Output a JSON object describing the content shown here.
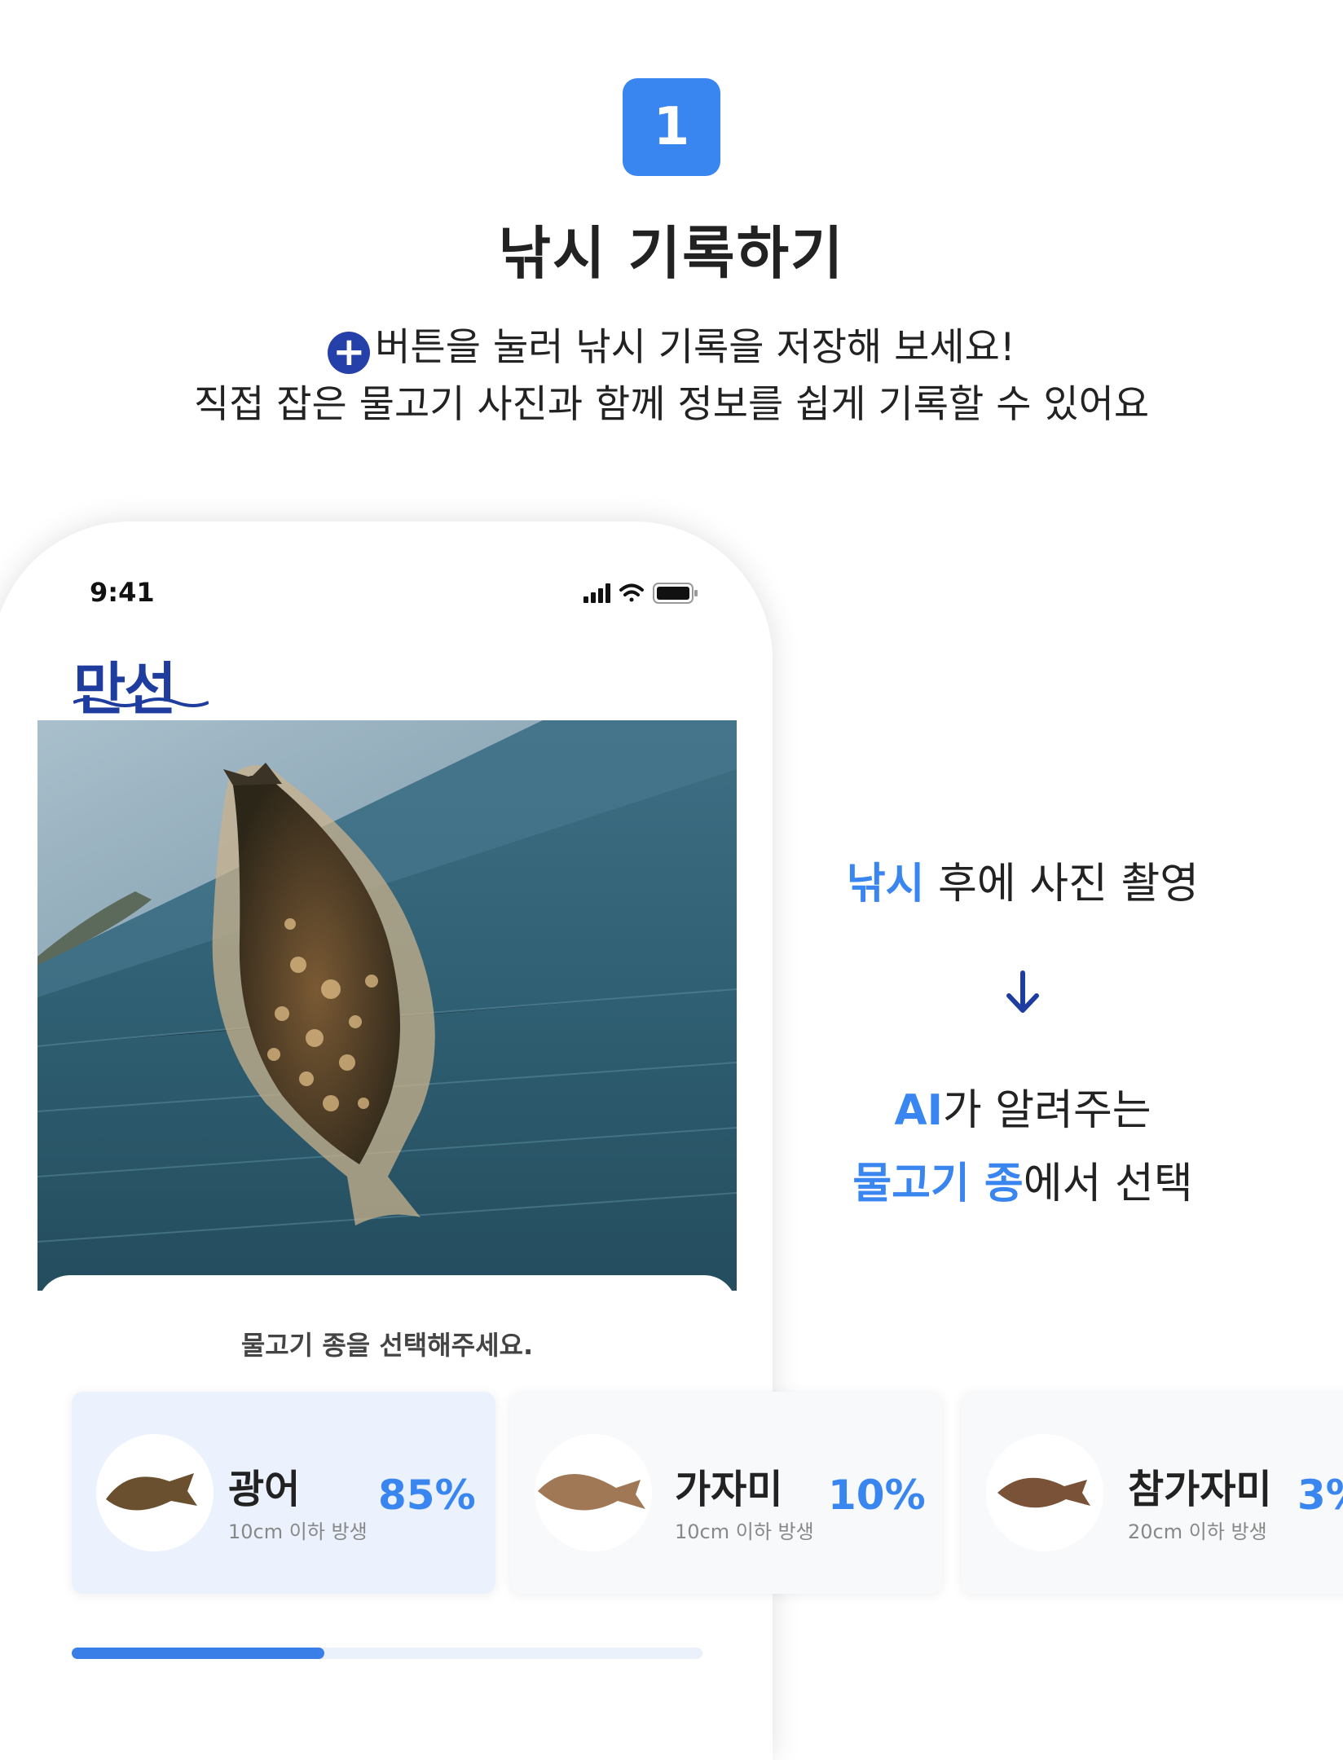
{
  "header": {
    "step_number": "1",
    "title": "낚시 기록하기",
    "desc_line1": "버튼을 눌러 낚시 기록을 저장해 보세요!",
    "desc_line2": "직접 잡은 물고기 사진과 함께 정보를 쉽게 기록할 수 있어요",
    "plus_icon_glyph": "+"
  },
  "phone": {
    "status_time": "9:41",
    "brand": "만선",
    "sheet_title": "물고기 종을 선택해주세요.",
    "species": [
      {
        "name": "광어",
        "sub": "10cm 이하 방생",
        "pct": "85%",
        "selected": true
      },
      {
        "name": "가자미",
        "sub": "10cm 이하 방생",
        "pct": "10%",
        "selected": false
      },
      {
        "name": "참가자미",
        "sub": "20cm 이하 방생",
        "pct": "3%",
        "selected": false
      }
    ],
    "progress_fraction": 0.4
  },
  "flow": {
    "step1_hl": "낚시",
    "step1_rest": " 후에 사진 촬영",
    "step2_hl_a": "AI",
    "step2_rest_a": "가 알려주는",
    "step2_hl_b": "물고기 종",
    "step2_rest_b": "에서 선택"
  },
  "colors": {
    "accent": "#3a86f0",
    "brand": "#1f3d9e",
    "selected_card": "#ebf2fd"
  },
  "icons": [
    "plus-icon",
    "signal-icon",
    "wifi-icon",
    "battery-icon",
    "arrow-down-icon"
  ]
}
